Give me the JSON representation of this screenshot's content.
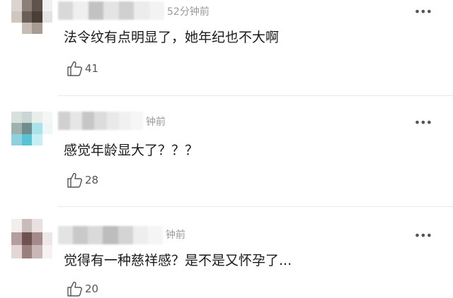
{
  "comments": [
    {
      "time": "52分钟前",
      "text": "法令纹有点明显了，她年纪也不大啊",
      "likes": "41",
      "avatar_colors": [
        "#d9d4cf",
        "#8c7f76",
        "#5e534d",
        "#f2f0ee",
        "#cfc6bf",
        "#6b5f58",
        "#4a3e38",
        "#e6e2df",
        "#ffffff",
        "#c7bdb5",
        "#a79c94",
        "#ffffff"
      ],
      "name_blur_colors": [
        "#d8d8d8",
        "#efefef",
        "#c2c2c2",
        "#e4e4e4",
        "#cfcfcf",
        "#ececec",
        "#f3f3f3"
      ]
    },
    {
      "time": "钟前",
      "text": "感觉年龄显大了？？？",
      "likes": "28",
      "avatar_colors": [
        "#d7e0dc",
        "#c9d6d3",
        "#e8eeec",
        "#f4f7f6",
        "#9fb2ae",
        "#6f8d8c",
        "#a9e3ea",
        "#eef6f7",
        "#8fd0de",
        "#59c3d6",
        "#c7eef4",
        "#ffffff"
      ],
      "name_blur_colors": [
        "#d0d0d0",
        "#e6e6e6",
        "#c6c6c6",
        "#dcdcdc",
        "#e9e9e9",
        "#f1f1f1",
        "#f6f6f6"
      ]
    },
    {
      "time": "钟前",
      "text": "觉得有一种慈祥感？是不是又怀孕了...",
      "likes": "20",
      "avatar_colors": [
        "#f3eeee",
        "#cbbcbc",
        "#e9e1e1",
        "#ffffff",
        "#b59d9d",
        "#6e5252",
        "#a58a8a",
        "#efe7e7",
        "#e3d6d6",
        "#9a7f7f",
        "#c9b6b6",
        "#f7f2f2"
      ],
      "name_blur_colors": [
        "#e3e3e3",
        "#c9c9c9",
        "#dadada",
        "#bdbdbd",
        "#d4d4d4",
        "#eeeeee",
        "#f5f5f5"
      ]
    }
  ],
  "more_label": "•••"
}
